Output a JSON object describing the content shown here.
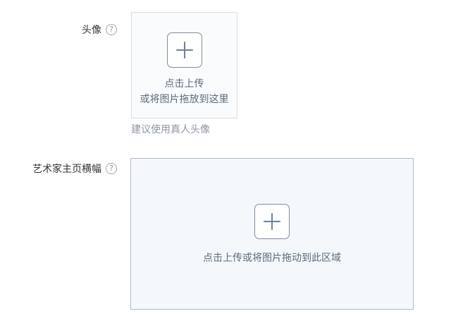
{
  "avatar": {
    "label": "头像",
    "help_icon": "question-circle-icon",
    "help_glyph": "?",
    "upload_line1": "点击上传",
    "upload_line2": "或将图片拖放到这里",
    "hint": "建议使用真人头像",
    "plus_icon": "plus-icon"
  },
  "banner": {
    "label": "艺术家主页横幅",
    "help_icon": "question-circle-icon",
    "help_glyph": "?",
    "upload_text": "点击上传或将图片拖动到此区域",
    "plus_icon": "plus-icon"
  },
  "colors": {
    "label_text": "#333333",
    "hint_text": "#8d96a0",
    "upload_text": "#5b6b7c",
    "icon_stroke": "#7c8da0",
    "banner_bg": "#f4f8fb",
    "banner_border": "#aebbc7",
    "avatar_bg": "#fafbfc",
    "avatar_border": "#d9dee4"
  }
}
